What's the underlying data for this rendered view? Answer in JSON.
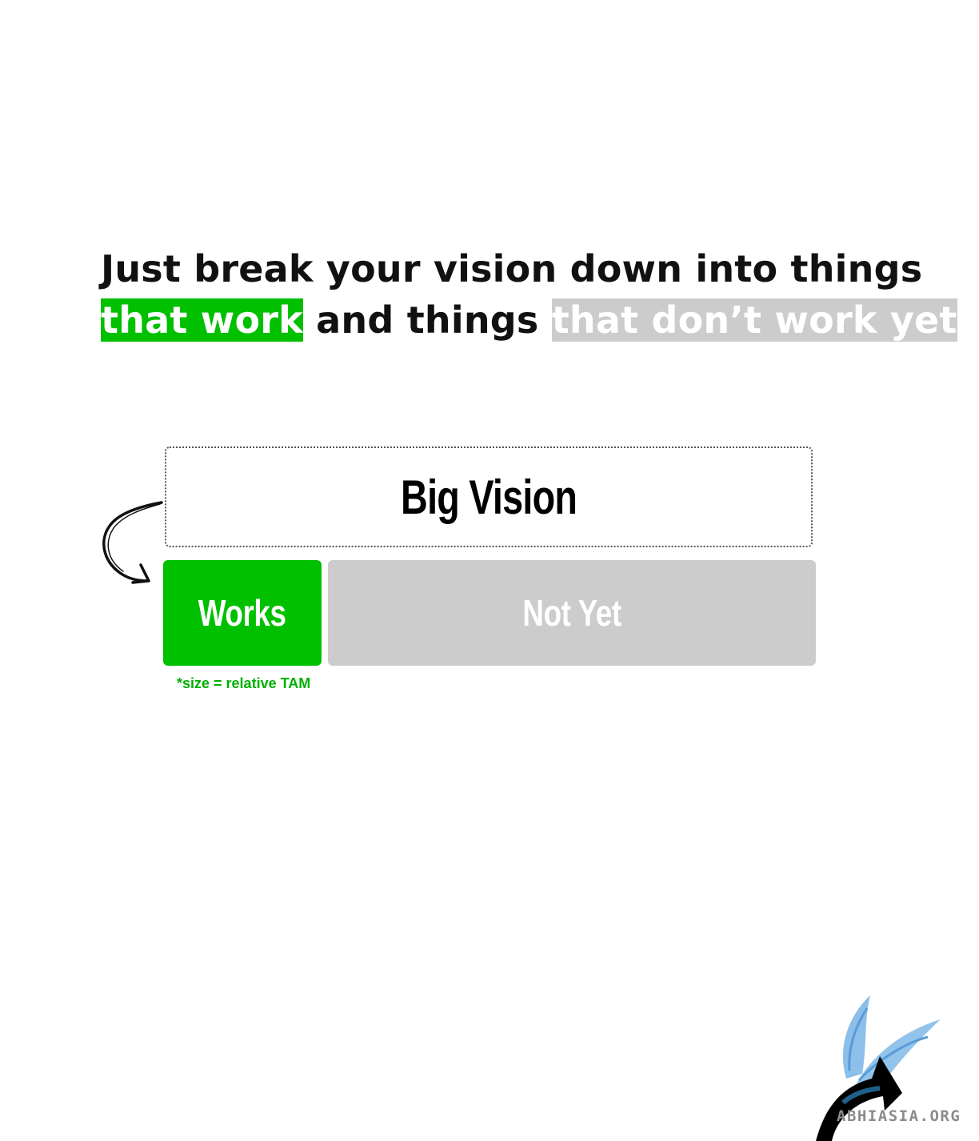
{
  "headline": {
    "line1": "Just break your vision down into things",
    "line2_highlight_works": "that work",
    "line2_middle": " and things ",
    "line2_highlight_notyet": "that don’t work yet"
  },
  "diagram": {
    "vision_label": "Big Vision",
    "works_label": "Works",
    "notyet_label": "Not Yet",
    "size_note": "*size = relative TAM"
  },
  "watermark": {
    "text": "ABHIASIA.ORG"
  },
  "colors": {
    "works_green": "#00c000",
    "notyet_grey": "#cccccc",
    "note_green": "#00b000"
  },
  "icons": {
    "arrow": "curved-arrow-icon",
    "logo": "bird-logo-icon"
  }
}
